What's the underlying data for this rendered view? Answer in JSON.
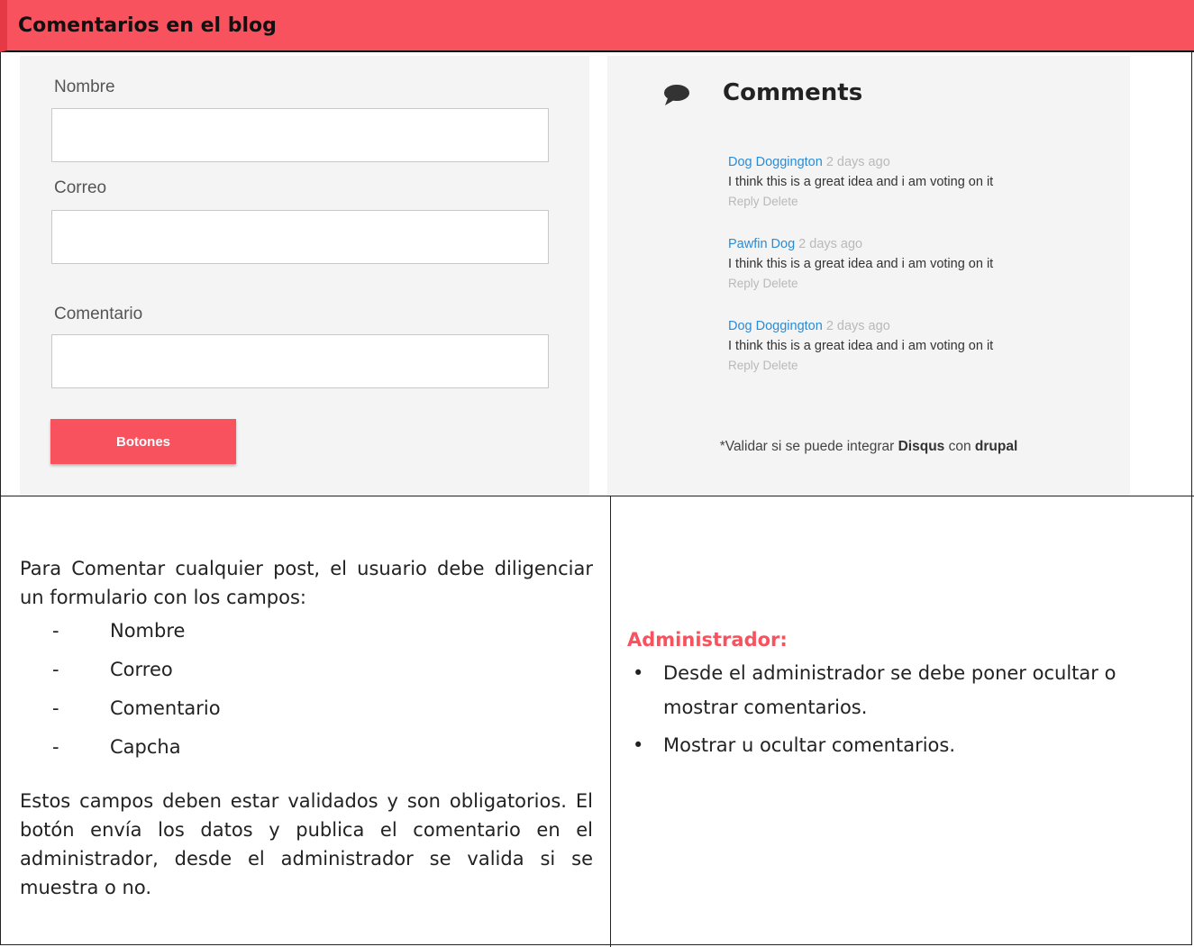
{
  "header": {
    "title": "Comentarios en el blog"
  },
  "form": {
    "name_label": "Nombre",
    "email_label": "Correo",
    "comment_label": "Comentario",
    "submit_label": "Botones"
  },
  "comments": {
    "title": "Comments",
    "items": [
      {
        "author": "Dog Doggington",
        "time": "2 days ago",
        "text": "I think this is a great idea and i am voting on it",
        "reply": "Reply",
        "delete": "Delete"
      },
      {
        "author": "Pawfin Dog",
        "time": "2 days ago",
        "text": "I think this is a great idea and i am voting on it",
        "reply": "Reply",
        "delete": "Delete"
      },
      {
        "author": "Dog Doggington",
        "time": "2 days ago",
        "text": "I think this is a great idea and i am voting on it",
        "reply": "Reply",
        "delete": "Delete"
      }
    ],
    "note_prefix": "*Validar si se puede integrar ",
    "note_disqus": "Disqus",
    "note_middle": " con ",
    "note_drupal": "drupal"
  },
  "description": {
    "intro": "Para Comentar cualquier post, el usuario debe diligenciar un formulario con los campos:",
    "fields": [
      "Nombre",
      "Correo",
      "Comentario",
      "Capcha"
    ],
    "dash": "-",
    "closing": "Estos campos deben estar validados y son obligatorios. El botón envía los datos y publica el comentario en el administrador, desde el administrador se valida si se muestra o no."
  },
  "admin": {
    "title": "Administrador:",
    "bullet": "•",
    "items": [
      "Desde el administrador se debe poner ocultar o mostrar comentarios.",
      "Mostrar u ocultar comentarios."
    ]
  },
  "colors": {
    "accent": "#f8525f",
    "link": "#2a8bd6",
    "muted": "#b9b9b9"
  }
}
